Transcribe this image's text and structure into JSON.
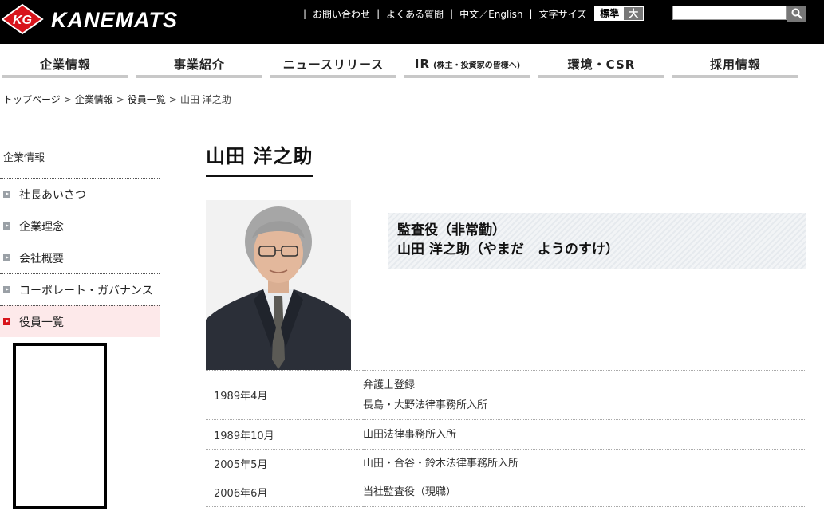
{
  "header": {
    "logo_text": "KANEMATS",
    "logo_badge": "KG",
    "links": [
      "お問い合わせ",
      "よくある質問",
      "中文／English"
    ],
    "font_size_label": "文字サイズ",
    "font_size_standard": "標準",
    "font_size_large": "大",
    "search": {
      "placeholder": ""
    }
  },
  "nav": {
    "items": [
      {
        "label": "企業情報"
      },
      {
        "label": "事業紹介"
      },
      {
        "label": "ニュースリリース"
      },
      {
        "label": "IR",
        "sub": "(株主・投資家の皆様へ)"
      },
      {
        "label": "環境・CSR"
      },
      {
        "label": "採用情報"
      }
    ]
  },
  "breadcrumb": {
    "items": [
      "トップページ",
      "企業情報",
      "役員一覧"
    ],
    "current": "山田 洋之助",
    "separator": ">"
  },
  "sidebar": {
    "title": "企業情報",
    "items": [
      {
        "label": "社長あいさつ",
        "active": false
      },
      {
        "label": "企業理念",
        "active": false
      },
      {
        "label": "会社概要",
        "active": false
      },
      {
        "label": "コーポレート・ガバナンス",
        "active": false
      },
      {
        "label": "役員一覧",
        "active": true
      }
    ]
  },
  "profile": {
    "title": "山田 洋之助",
    "role": "監査役（非常勤）",
    "name_with_reading": "山田 洋之助（やまだ　ようのすけ）",
    "history": [
      {
        "date": "1989年4月",
        "lines": [
          "弁護士登録",
          "長島・大野法律事務所入所"
        ]
      },
      {
        "date": "1989年10月",
        "lines": [
          "山田法律事務所入所"
        ]
      },
      {
        "date": "2005年5月",
        "lines": [
          "山田・合谷・鈴木法律事務所入所"
        ]
      },
      {
        "date": "2006年6月",
        "lines": [
          "当社監査役（現職）"
        ]
      }
    ]
  },
  "colors": {
    "header_bg": "#000000",
    "accent_red": "#d8141b",
    "active_bg": "#fde9ea"
  }
}
